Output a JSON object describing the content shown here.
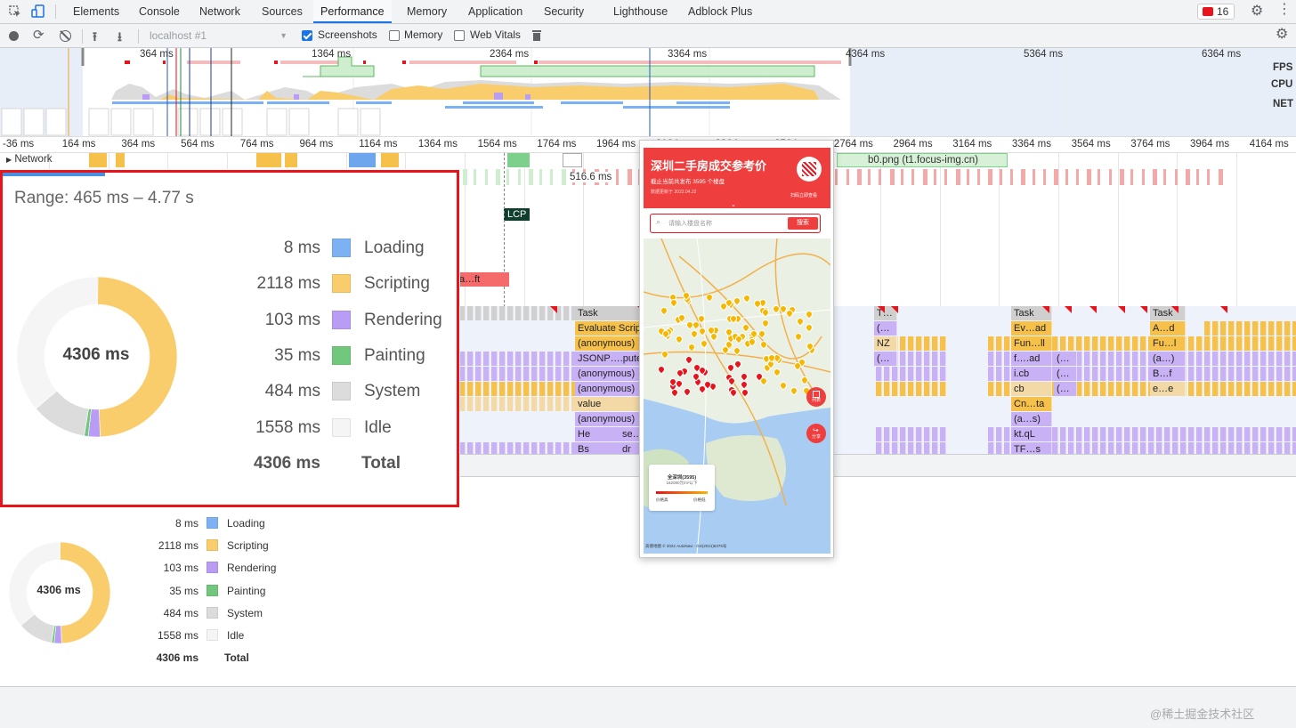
{
  "devtools": {
    "tabs": [
      "Elements",
      "Console",
      "Network",
      "Sources",
      "Performance",
      "Memory",
      "Application",
      "Security",
      "Lighthouse",
      "Adblock Plus"
    ],
    "active_tab": "Performance",
    "error_count": "16"
  },
  "toolbar": {
    "profile_select": "localhost #1",
    "screenshots_label": "Screenshots",
    "screenshots_checked": true,
    "memory_label": "Memory",
    "memory_checked": false,
    "webvitals_label": "Web Vitals",
    "webvitals_checked": false
  },
  "overview": {
    "ticks": [
      "364 ms",
      "1364 ms",
      "2364 ms",
      "3364 ms",
      "4364 ms",
      "5364 ms",
      "6364 ms"
    ],
    "tracks": {
      "fps": "FPS",
      "cpu": "CPU",
      "net": "NET"
    }
  },
  "timeline": {
    "ruler": [
      "-36 ms",
      "164 ms",
      "364 ms",
      "564 ms",
      "764 ms",
      "964 ms",
      "1164 ms",
      "1364 ms",
      "1564 ms",
      "1764 ms",
      "1964 ms",
      "2164 ms",
      "2364 ms",
      "2564 ms",
      "2764 ms",
      "2964 ms",
      "3164 ms",
      "3364 ms",
      "3564 ms",
      "3764 ms",
      "3964 ms",
      "4164 ms"
    ],
    "network_label": "Network",
    "network_request": "b0.png (t1.focus-img.cn)",
    "frame_time": "516.6 ms",
    "lcp_label": "LCP",
    "timing_block": "a…ft",
    "flame_col1": [
      "Task",
      "Evaluate Script",
      "(anonymous)",
      "JSONP….pute",
      "(anonymous)",
      "(anonymous)",
      "value",
      "(anonymous)",
      "He",
      "Bs"
    ],
    "flame_col1b": [
      "se…",
      "dr",
      "Bs"
    ],
    "flame_col2": [
      "T…",
      "(…",
      "NZ",
      "(…"
    ],
    "flame_col3": [
      "Task",
      "Ev…ad",
      "Fun…ll",
      "f….ad",
      "i.cb",
      "cb",
      "Cn…ta",
      "(a…s)",
      "kt.qL",
      "TF…s"
    ],
    "flame_col3b": [
      "(…",
      "(…",
      "(…"
    ],
    "flame_col4": [
      "Task",
      "A…d",
      "Fu…l",
      "(a…)",
      "B…f",
      "e…e"
    ]
  },
  "summary": {
    "range": "Range: 465 ms – 4.77 s",
    "total_center": "4306 ms",
    "rows": [
      {
        "value": "8 ms",
        "label": "Loading",
        "color": "#7cb2f3"
      },
      {
        "value": "2118 ms",
        "label": "Scripting",
        "color": "#f9cd6b"
      },
      {
        "value": "103 ms",
        "label": "Rendering",
        "color": "#b99cf4"
      },
      {
        "value": "35 ms",
        "label": "Painting",
        "color": "#71c87d"
      },
      {
        "value": "484 ms",
        "label": "System",
        "color": "#dcdcdc"
      },
      {
        "value": "1558 ms",
        "label": "Idle",
        "color": "#f5f5f5"
      }
    ],
    "total_value": "4306 ms",
    "total_label": "Total",
    "chart_data": {
      "type": "pie",
      "categories": [
        "Loading",
        "Scripting",
        "Rendering",
        "Painting",
        "System",
        "Idle"
      ],
      "values": [
        8,
        2118,
        103,
        35,
        484,
        1558
      ],
      "total": 4306
    }
  },
  "screenshot": {
    "title": "深圳二手房成交参考价",
    "subtitle": "截止当前共发布 3595 个楼盘",
    "update": "数据更新于 2022.04.22",
    "scan_label": "扫码立即查看",
    "search_placeholder": "请输入楼盘名称",
    "search_button": "搜索",
    "list_label": "列表",
    "share_label": "分享",
    "legend_title": "全深圳(3595)",
    "legend_price": "182080元/m²以下",
    "legend_high": "价格高",
    "legend_low": "价格低",
    "copyright": "高德地图  © 2022 AutoNavi - GS(2021)6375号"
  },
  "watermark": "@稀土掘金技术社区"
}
